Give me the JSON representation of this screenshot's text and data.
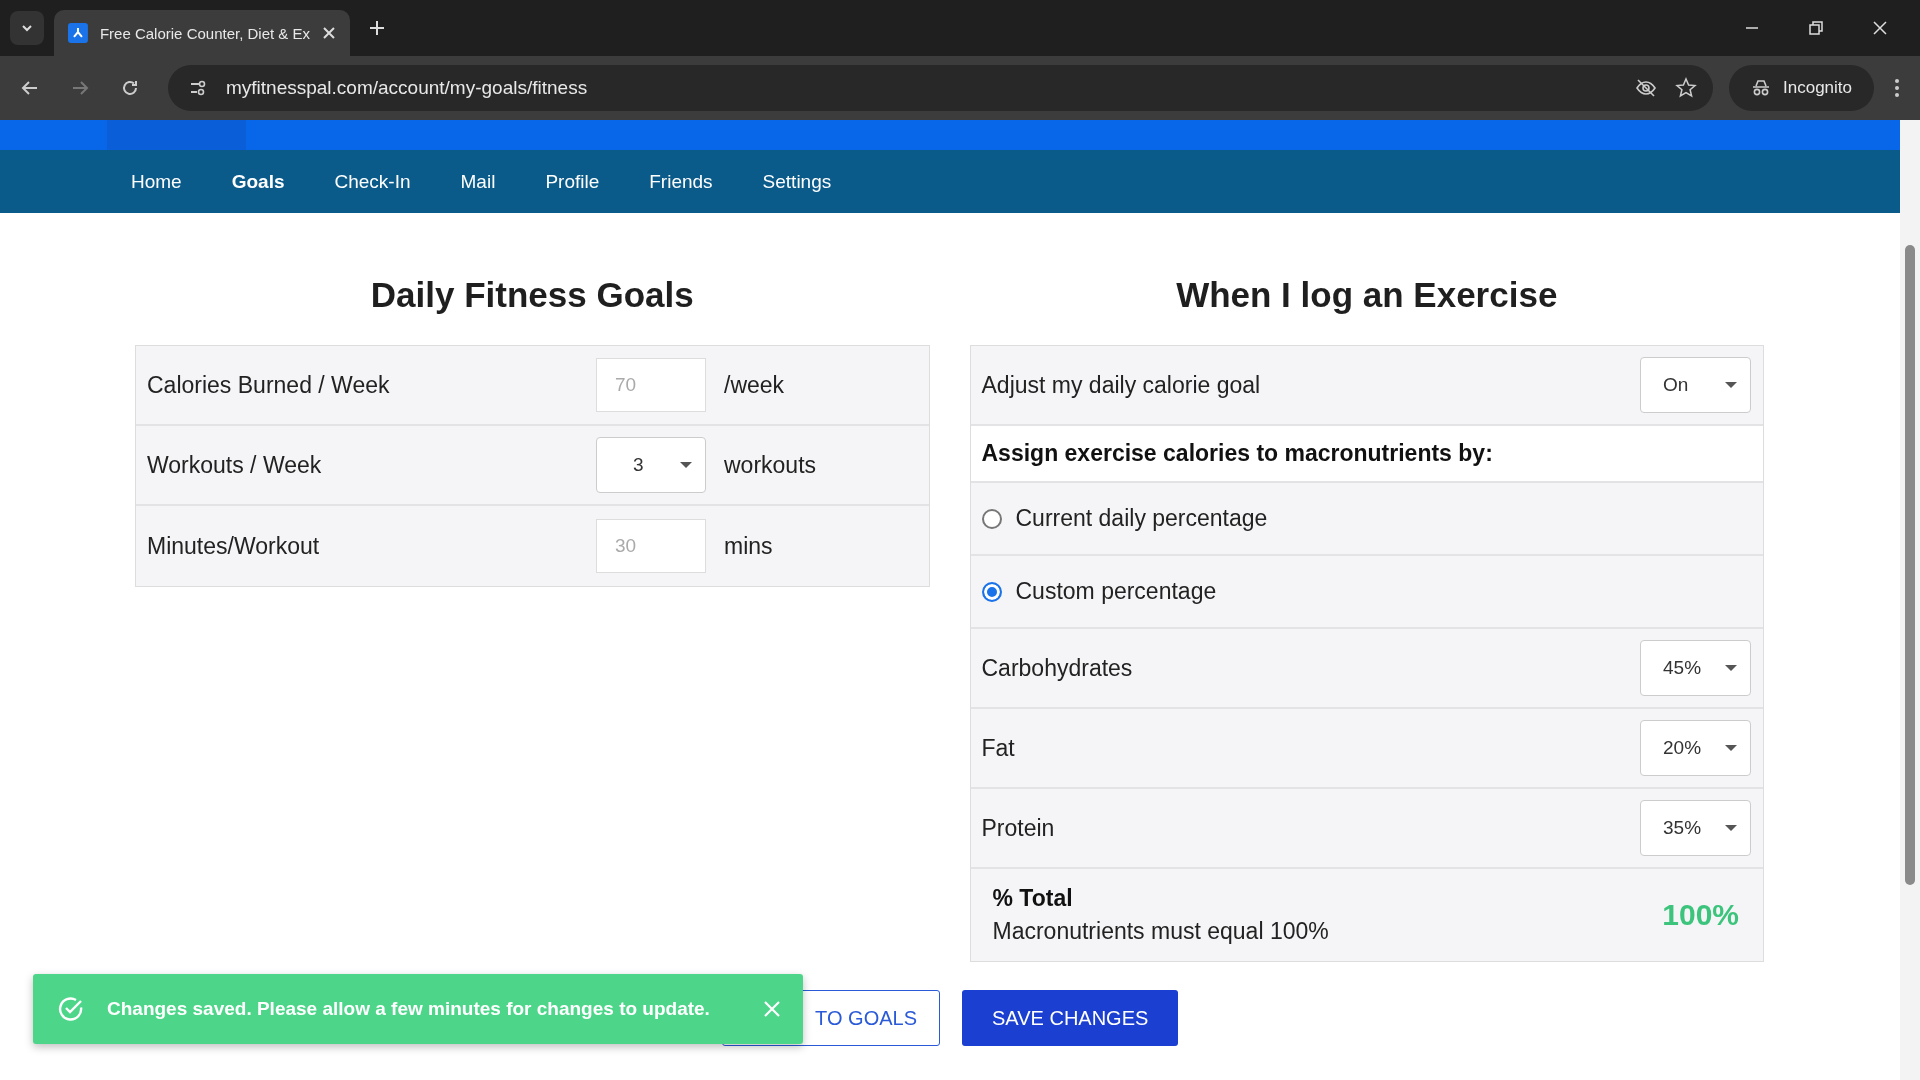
{
  "browser": {
    "tab_title": "Free Calorie Counter, Diet & Ex",
    "url": "myfitnesspal.com/account/my-goals/fitness",
    "profile": "Incognito"
  },
  "subnav": [
    {
      "label": "Home",
      "selected": false
    },
    {
      "label": "Goals",
      "selected": true
    },
    {
      "label": "Check-In",
      "selected": false
    },
    {
      "label": "Mail",
      "selected": false
    },
    {
      "label": "Profile",
      "selected": false
    },
    {
      "label": "Friends",
      "selected": false
    },
    {
      "label": "Settings",
      "selected": false
    }
  ],
  "fitness": {
    "title": "Daily Fitness Goals",
    "rows": [
      {
        "kind": "input",
        "label": "Calories Burned / Week",
        "placeholder": "70",
        "unit": "/week"
      },
      {
        "kind": "select",
        "label": "Workouts / Week",
        "value": "3",
        "unit": "workouts"
      },
      {
        "kind": "input",
        "label": "Minutes/Workout",
        "placeholder": "30",
        "unit": "mins"
      }
    ]
  },
  "exercise": {
    "title": "When I log an Exercise",
    "adjust": {
      "label": "Adjust my daily calorie goal",
      "value": "On"
    },
    "assign_heading": "Assign exercise calories to macronutrients by:",
    "options": [
      {
        "label": "Current daily percentage",
        "selected": false
      },
      {
        "label": "Custom percentage",
        "selected": true
      }
    ],
    "macros": [
      {
        "label": "Carbohydrates",
        "value": "45%"
      },
      {
        "label": "Fat",
        "value": "20%"
      },
      {
        "label": "Protein",
        "value": "35%"
      }
    ],
    "total": {
      "label": "% Total",
      "note": "Macronutrients must equal 100%",
      "value": "100%"
    }
  },
  "buttons": {
    "back": "TO GOALS",
    "save": "SAVE CHANGES"
  },
  "toast": {
    "message": "Changes saved. Please allow a few minutes for changes to update."
  }
}
